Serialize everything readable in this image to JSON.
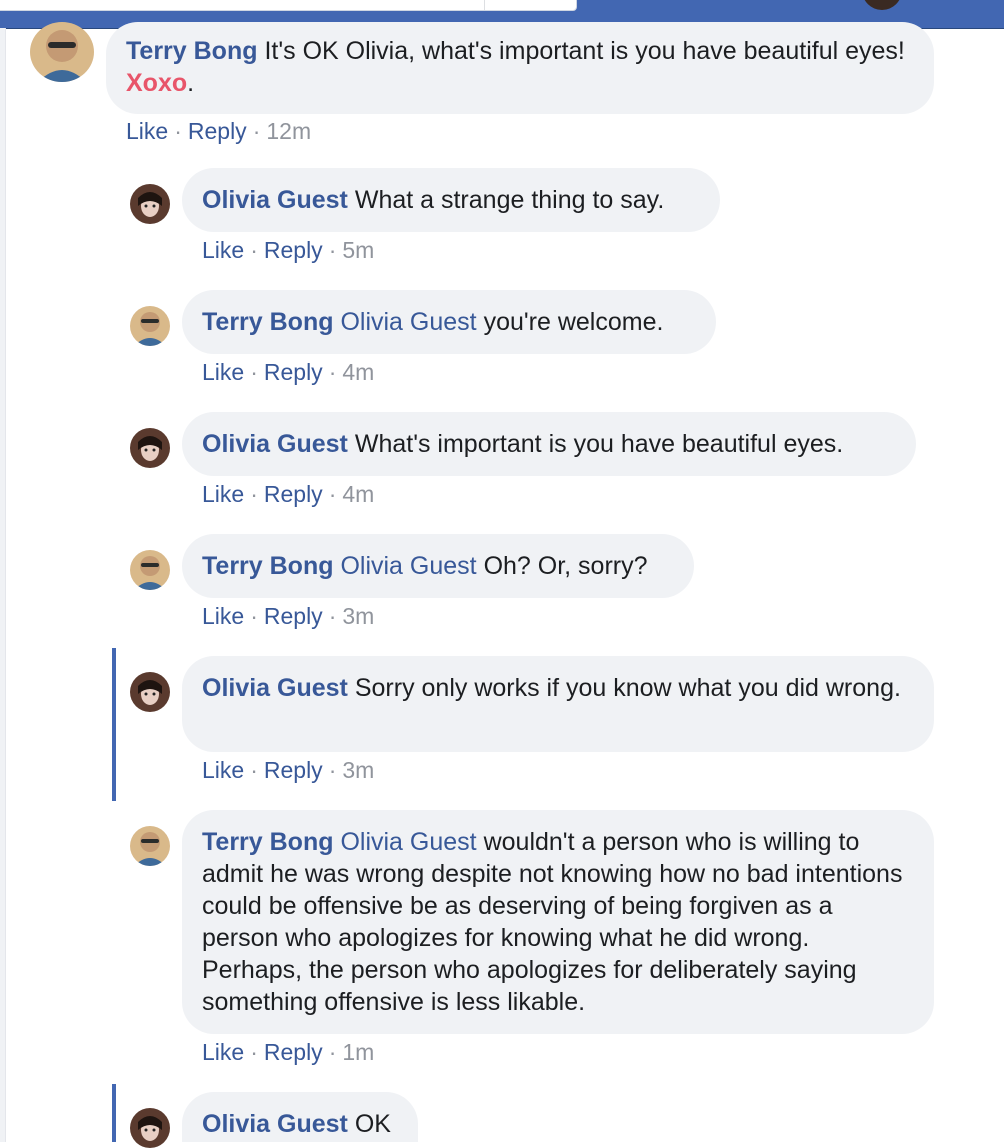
{
  "comments": [
    {
      "author": "Terry Bong",
      "mention": "",
      "text": "It's OK Olivia, what's important is you have beautiful eyes!",
      "emphasis": "Xoxo",
      "trailing": ".",
      "like": "Like",
      "reply": "Reply",
      "time": "12m"
    },
    {
      "author": "Olivia Guest",
      "mention": "",
      "text": "What a strange thing to say.",
      "like": "Like",
      "reply": "Reply",
      "time": "5m"
    },
    {
      "author": "Terry Bong",
      "mention": "Olivia Guest",
      "text": "you're welcome.",
      "like": "Like",
      "reply": "Reply",
      "time": "4m"
    },
    {
      "author": "Olivia Guest",
      "mention": "",
      "text": "What's important is you have beautiful eyes.",
      "like": "Like",
      "reply": "Reply",
      "time": "4m"
    },
    {
      "author": "Terry Bong",
      "mention": "Olivia Guest",
      "text": "Oh? Or, sorry?",
      "like": "Like",
      "reply": "Reply",
      "time": "3m"
    },
    {
      "author": "Olivia Guest",
      "mention": "",
      "text": "Sorry only works if you know what you did wrong.",
      "like": "Like",
      "reply": "Reply",
      "time": "3m"
    },
    {
      "author": "Terry Bong",
      "mention": "Olivia Guest",
      "text": "wouldn't a person who is willing to admit he was wrong despite not knowing how no bad intentions could be offensive be as deserving of being forgiven as a person who apologizes for knowing what he did wrong. Perhaps, the person who apologizes for deliberately saying something offensive is less likable.",
      "like": "Like",
      "reply": "Reply",
      "time": "1m"
    },
    {
      "author": "Olivia Guest",
      "mention": "",
      "text": "OK"
    }
  ],
  "colors": {
    "topbar": "#4267b2",
    "name": "#385898",
    "bubble": "#f0f2f5",
    "emphasis": "#e8556a",
    "highlight": "#4267b2"
  },
  "icons": {
    "terry_avatar": "user-avatar-terry-bong",
    "olivia_avatar": "user-avatar-olivia-guest"
  }
}
